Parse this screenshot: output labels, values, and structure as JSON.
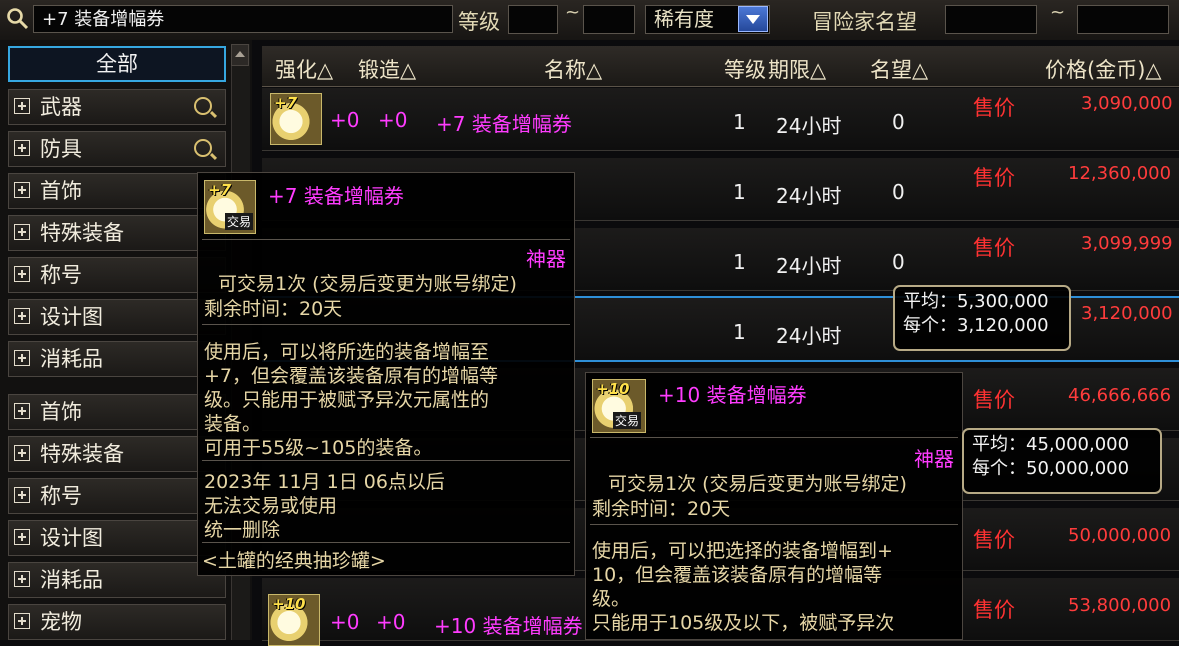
{
  "search": {
    "value": "+7 装备增幅券"
  },
  "filters": {
    "level_label": "等级",
    "tilde": "~",
    "rarity_value": "稀有度",
    "reputation_label": "冒险家名望"
  },
  "sidebar": {
    "all_label": "全部",
    "items": [
      {
        "label": "武器"
      },
      {
        "label": "防具"
      },
      {
        "label": "首饰"
      },
      {
        "label": "特殊装备"
      },
      {
        "label": "称号"
      },
      {
        "label": "设计图"
      },
      {
        "label": "消耗品"
      },
      {
        "label": "首饰"
      },
      {
        "label": "特殊装备"
      },
      {
        "label": "称号"
      },
      {
        "label": "设计图"
      },
      {
        "label": "消耗品"
      },
      {
        "label": "宠物"
      }
    ]
  },
  "table": {
    "headers": {
      "enhance": "强化△",
      "forge": "锻造△",
      "name": "名称△",
      "level": "等级",
      "duration": "期限△",
      "reputation": "名望△",
      "price": "价格(金币)△"
    },
    "price_label": "售价",
    "rows": [
      {
        "enhance": "+0",
        "forge": "+0",
        "name": "+7 装备增幅券",
        "level": "1",
        "duration": "24小时",
        "reputation": "0",
        "price": "3,090,000",
        "icon_level": "+7"
      },
      {
        "level": "1",
        "duration": "24小时",
        "reputation": "0",
        "price": "12,360,000"
      },
      {
        "level": "1",
        "duration": "24小时",
        "reputation": "0",
        "price": "3,099,999"
      },
      {
        "level": "1",
        "duration": "24小时",
        "price": "3,120,000"
      },
      {
        "price": "46,666,666"
      },
      {
        "price": "50,000,000"
      },
      {
        "price": "50,000,000"
      },
      {
        "enhance": "+0",
        "forge": "+0",
        "name": "+10 装备增幅券",
        "price": "53,800,000",
        "icon_level": "+10"
      }
    ]
  },
  "avg_popup_1": {
    "avg": "平均：5,300,000",
    "each": "每个：3,120,000"
  },
  "avg_popup_2": {
    "avg": "平均：45,000,000",
    "each": "每个：50,000,000"
  },
  "tooltip_1": {
    "title": "+7 装备增幅券",
    "icon_level": "+7",
    "trade_badge": "交易",
    "rarity": "神器",
    "trade_info": "可交易1次 (交易后变更为账号绑定)",
    "remaining": "剩余时间：20天",
    "desc_1": "使用后，可以将所选的装备增幅至",
    "desc_2": "+7，但会覆盖该装备原有的增幅等",
    "desc_3": "级。只能用于被赋予异次元属性的",
    "desc_4": "装备。",
    "desc_5": "可用于55级~105的装备。",
    "expire_1": "2023年 11月 1日 06点以后",
    "expire_2": "无法交易或使用",
    "expire_3": "统一删除",
    "source": "<土罐的经典抽珍罐>"
  },
  "tooltip_2": {
    "title": "+10 装备增幅券",
    "icon_level": "+10",
    "trade_badge": "交易",
    "rarity": "神器",
    "trade_info": "可交易1次 (交易后变更为账号绑定)",
    "remaining": "剩余时间：20天",
    "desc_1": "使用后，可以把选择的装备增幅到+",
    "desc_2": "10，但会覆盖该装备原有的增幅等",
    "desc_3": "级。",
    "desc_4": "只能用于105级及以下，被赋予异次"
  },
  "colors": {
    "accent_blue": "#2e8fd8",
    "price_red": "#ff3c3c",
    "name_magenta": "#ff3cff"
  }
}
